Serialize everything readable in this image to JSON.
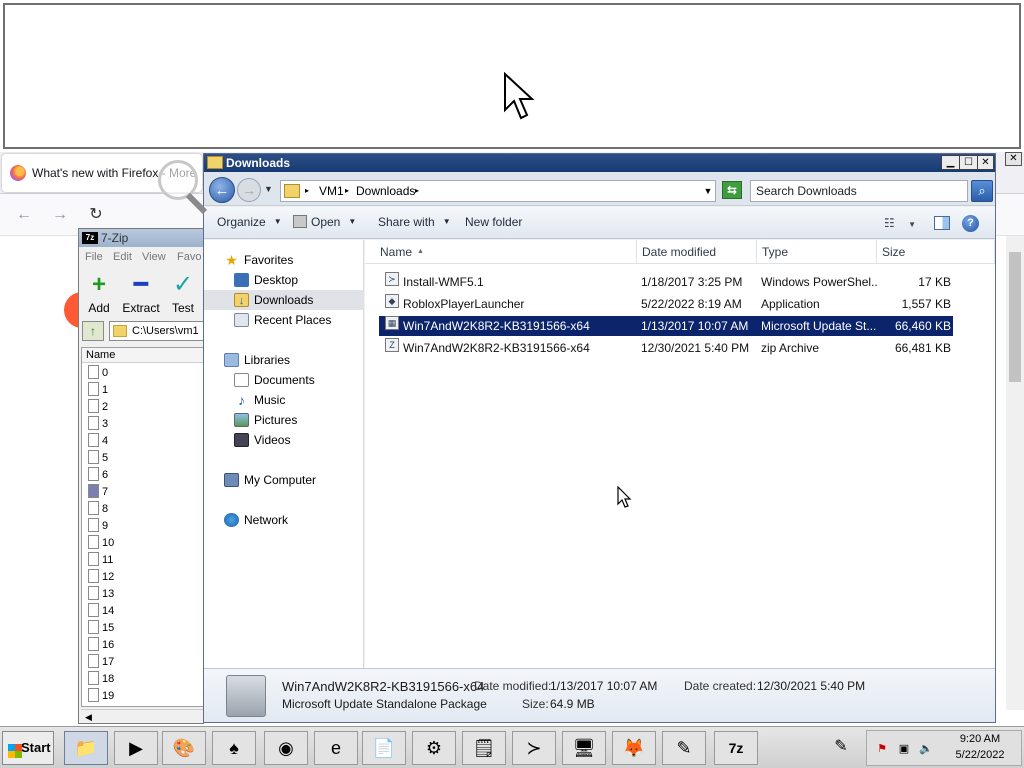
{
  "firefox": {
    "tab_title": "What's new with Firefox - More pr",
    "back_glyph": "←",
    "forward_glyph": "→",
    "reload_glyph": "↻"
  },
  "sevenzip": {
    "title": "7-Zip",
    "icon_text": "7z",
    "menu": [
      "File",
      "Edit",
      "View",
      "Favo"
    ],
    "tools": [
      {
        "label": "Add",
        "glyph": "+",
        "color": "#1e9a1e"
      },
      {
        "label": "Extract",
        "glyph": "━",
        "color": "#1d3fbf"
      },
      {
        "label": "Test",
        "glyph": "✓",
        "color": "#1aa3a3"
      }
    ],
    "path": "C:\\Users\\vm1",
    "column_name": "Name",
    "rows": [
      "0",
      "1",
      "2",
      "3",
      "4",
      "5",
      "6",
      "7",
      "8",
      "9",
      "10",
      "11",
      "12",
      "13",
      "14",
      "15",
      "16",
      "17",
      "18",
      "19"
    ],
    "scroll_left": "◀"
  },
  "explorer": {
    "title": "Downloads",
    "breadcrumb": [
      "VM1",
      "Downloads"
    ],
    "search_placeholder": "Search Downloads",
    "commands": {
      "organize": "Organize",
      "open": "Open",
      "share_with": "Share with",
      "new_folder": "New folder"
    },
    "nav": {
      "favorites": "Favorites",
      "desktop": "Desktop",
      "downloads": "Downloads",
      "recent_places": "Recent Places",
      "libraries": "Libraries",
      "documents": "Documents",
      "music": "Music",
      "pictures": "Pictures",
      "videos": "Videos",
      "my_computer": "My Computer",
      "network": "Network"
    },
    "columns": {
      "name": "Name",
      "date_modified": "Date modified",
      "type": "Type",
      "size": "Size"
    },
    "files": [
      {
        "name": "Install-WMF5.1",
        "date": "1/18/2017 3:25 PM",
        "type": "Windows PowerShel...",
        "size": "17 KB",
        "selected": false
      },
      {
        "name": "RobloxPlayerLauncher",
        "date": "5/22/2022 8:19 AM",
        "type": "Application",
        "size": "1,557 KB",
        "selected": false
      },
      {
        "name": "Win7AndW2K8R2-KB3191566-x64",
        "date": "1/13/2017 10:07 AM",
        "type": "Microsoft Update St...",
        "size": "66,460 KB",
        "selected": true
      },
      {
        "name": "Win7AndW2K8R2-KB3191566-x64",
        "date": "12/30/2021 5:40 PM",
        "type": "zip Archive",
        "size": "66,481 KB",
        "selected": false
      }
    ],
    "details": {
      "name": "Win7AndW2K8R2-KB3191566-x64",
      "type": "Microsoft Update Standalone Package",
      "date_modified_label": "Date modified:",
      "date_modified": "1/13/2017 10:07 AM",
      "date_created_label": "Date created:",
      "date_created": "12/30/2021 5:40 PM",
      "size_label": "Size:",
      "size": "64.9 MB"
    }
  },
  "taskbar": {
    "start_label": "Start",
    "time": "9:20 AM",
    "date": "5/22/2022",
    "apps": [
      {
        "name": "explorer",
        "glyph": "📁"
      },
      {
        "name": "media-player",
        "glyph": "▶"
      },
      {
        "name": "paint",
        "glyph": "🎨"
      },
      {
        "name": "solitaire",
        "glyph": "♠"
      },
      {
        "name": "chrome",
        "glyph": "◉"
      },
      {
        "name": "internet-explorer",
        "glyph": "e"
      },
      {
        "name": "notepad",
        "glyph": "📄"
      },
      {
        "name": "control-panel",
        "glyph": "⚙"
      },
      {
        "name": "sticky-notes",
        "glyph": "🗒"
      },
      {
        "name": "powershell",
        "glyph": "≻"
      },
      {
        "name": "remote-desktop",
        "glyph": "🖥"
      },
      {
        "name": "firefox",
        "glyph": "🦊"
      },
      {
        "name": "notes",
        "glyph": "✎"
      },
      {
        "name": "7-zip",
        "glyph": "7z"
      }
    ]
  }
}
